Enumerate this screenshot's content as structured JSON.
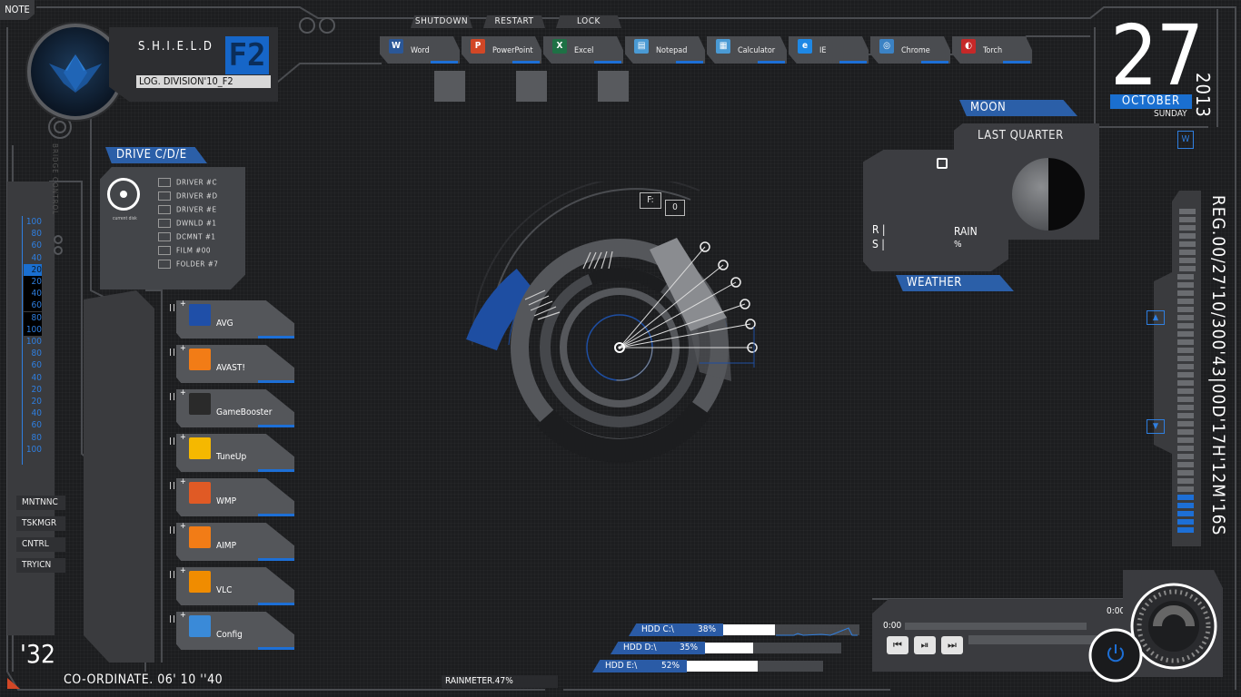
{
  "note_label": "NOTE",
  "header": {
    "title": "S.H.I.E.L.D",
    "badge": "F2",
    "subtitle": "LOG. DIVISION'10_F2",
    "side_text": "BRIDGE CONTROL"
  },
  "top_buttons": [
    "SHUTDOWN",
    "RESTART",
    "LOCK"
  ],
  "apps": [
    {
      "label": "Word",
      "icon": "word-icon",
      "icon_text": "W",
      "color": "#2b5797"
    },
    {
      "label": "PowerPoint",
      "icon": "powerpoint-icon",
      "icon_text": "P",
      "color": "#d24726"
    },
    {
      "label": "Excel",
      "icon": "excel-icon",
      "icon_text": "X",
      "color": "#1e7145"
    },
    {
      "label": "Notepad",
      "icon": "notepad-icon",
      "icon_text": "▤",
      "color": "#4a9ad4"
    },
    {
      "label": "Calculator",
      "icon": "calculator-icon",
      "icon_text": "▦",
      "color": "#4a9ad4"
    },
    {
      "label": "IE",
      "icon": "ie-icon",
      "icon_text": "e",
      "color": "#1e88e5"
    },
    {
      "label": "Chrome",
      "icon": "chrome-icon",
      "icon_text": "◎",
      "color": "#3b82c4"
    },
    {
      "label": "Torch",
      "icon": "torch-icon",
      "icon_text": "◐",
      "color": "#c62828"
    }
  ],
  "date": {
    "day": "27",
    "month": "OCTOBER",
    "weekday": "SUNDAY",
    "year": "2013"
  },
  "reg_time": "REG.00/27'10/300'43|00D'17H'12M'16S",
  "drive": {
    "title": "DRIVE C/D/E",
    "disk_label": "current disk",
    "items": [
      "DRIVER #C",
      "DRIVER #D",
      "DRIVER #E",
      "DWNLD #1",
      "DCMNT #1",
      "FILM #00",
      "FOLDER #7"
    ]
  },
  "launchers": [
    {
      "label": "AVG",
      "icon": "avg-icon",
      "color": "#1f4fa8"
    },
    {
      "label": "AVAST!",
      "icon": "avast-icon",
      "color": "#f27c16"
    },
    {
      "label": "GameBooster",
      "icon": "gamebooster-icon",
      "color": "#2a2a2a"
    },
    {
      "label": "TuneUp",
      "icon": "tuneup-icon",
      "color": "#f5b800"
    },
    {
      "label": "WMP",
      "icon": "wmp-icon",
      "color": "#e05a25"
    },
    {
      "label": "AIMP",
      "icon": "aimp-icon",
      "color": "#f27c16"
    },
    {
      "label": "VLC",
      "icon": "vlc-icon",
      "color": "#f08c00"
    },
    {
      "label": "Config",
      "icon": "config-icon",
      "color": "#3a8ad8"
    }
  ],
  "scale_numbers": [
    "100",
    "80",
    "60",
    "40",
    "20",
    "20",
    "40",
    "60",
    "80",
    "100",
    "100",
    "80",
    "60",
    "40",
    "20",
    "20",
    "40",
    "60",
    "80",
    "100"
  ],
  "side_buttons": [
    "MNTNNC",
    "TSKMGR",
    "CNTRL",
    "TRYICN"
  ],
  "footer": {
    "big_number": "'32",
    "coordinate": "CO-ORDINATE. 06' 10 ''40",
    "rainmeter": "RAINMETER.47%"
  },
  "radar": {
    "label_f": "F:",
    "value": "0"
  },
  "moon": {
    "title": "MOON",
    "phase": "LAST QUARTER"
  },
  "weather": {
    "title": "WEATHER",
    "r_label": "R |",
    "s_label": "S |",
    "rain_label": "RAIN",
    "rain_unit": "%"
  },
  "hdd": [
    {
      "label": "HDD C:\\",
      "percent_text": "38%",
      "percent": 38
    },
    {
      "label": "HDD D:\\",
      "percent_text": "35%",
      "percent": 35
    },
    {
      "label": "HDD E:\\",
      "percent_text": "52%",
      "percent": 52
    }
  ],
  "media": {
    "time_start": "0:00",
    "time_end": "0:00",
    "prev": "⏮",
    "playpause": "⏯",
    "next": "⏭"
  },
  "volume_level": 0.12,
  "colors": {
    "accent": "#1a6fd0",
    "panel": "#3c3d41",
    "bg": "#1c1d1f"
  }
}
